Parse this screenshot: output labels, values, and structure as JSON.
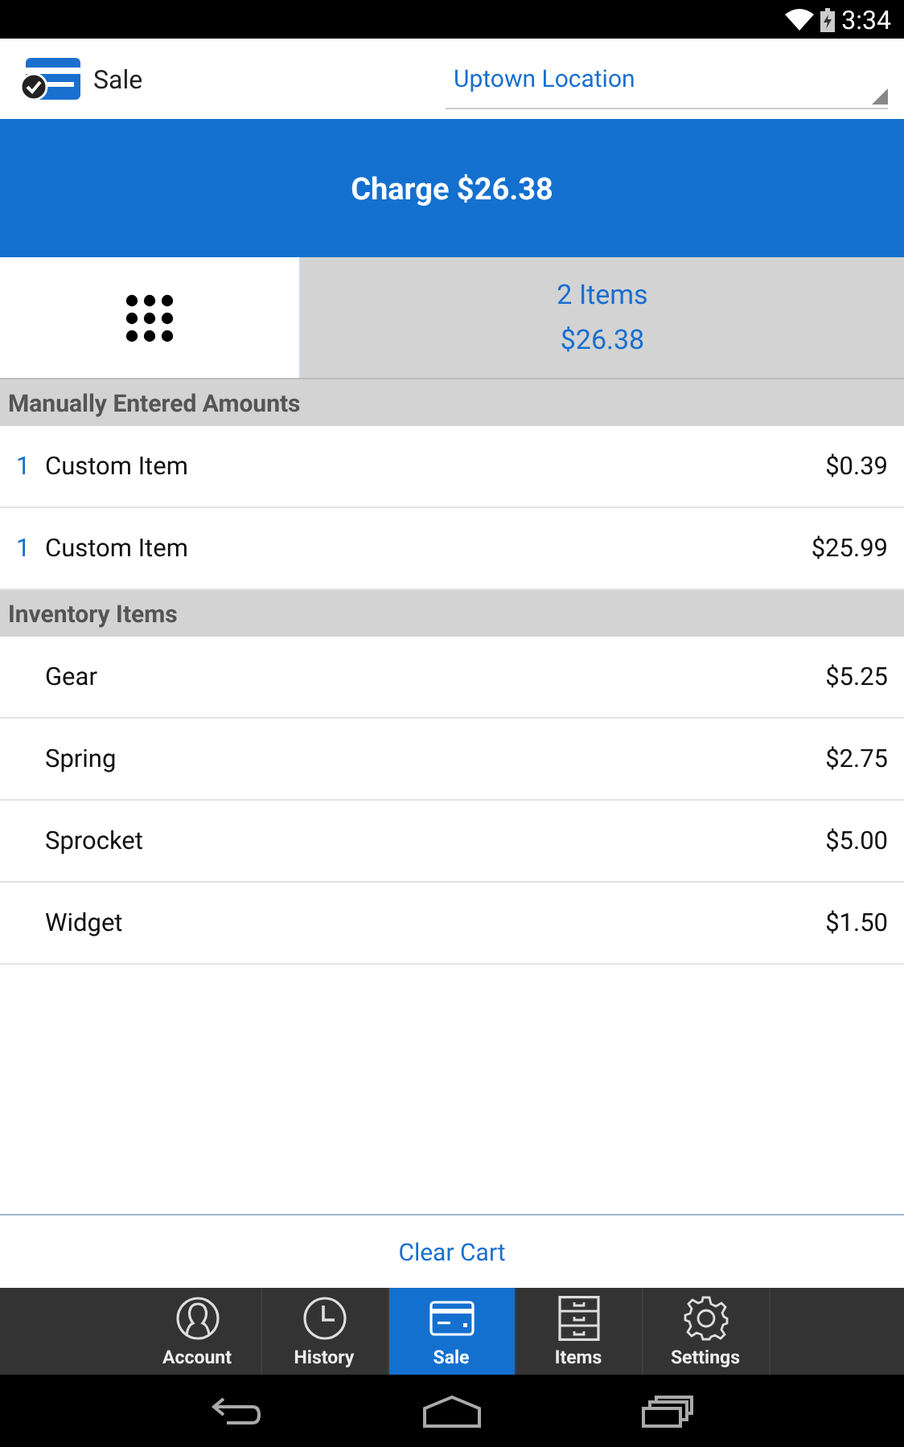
{
  "status_bar": {
    "time": "3:34"
  },
  "header": {
    "title": "Sale",
    "location": "Uptown Location"
  },
  "charge_button": "Charge $26.38",
  "cart_summary": {
    "count": "2 Items",
    "total": "$26.38"
  },
  "sections": [
    {
      "title": "Manually Entered Amounts",
      "rows": [
        {
          "quantity": "1",
          "name": "Custom Item",
          "price": "$0.39"
        },
        {
          "quantity": "1",
          "name": "Custom Item",
          "price": "$25.99"
        }
      ]
    },
    {
      "title": "Inventory Items",
      "rows": [
        {
          "name": "Gear",
          "price": "$5.25"
        },
        {
          "name": "Spring",
          "price": "$2.75"
        },
        {
          "name": "Sprocket",
          "price": "$5.00"
        },
        {
          "name": "Widget",
          "price": "$1.50"
        }
      ]
    }
  ],
  "clear_cart": "Clear Cart",
  "tabs": [
    {
      "label": "Account",
      "kind": "account",
      "selected": false
    },
    {
      "label": "History",
      "kind": "history",
      "selected": false
    },
    {
      "label": "Sale",
      "kind": "sale",
      "selected": true
    },
    {
      "label": "Items",
      "kind": "items",
      "selected": false
    },
    {
      "label": "Settings",
      "kind": "settings",
      "selected": false
    }
  ]
}
